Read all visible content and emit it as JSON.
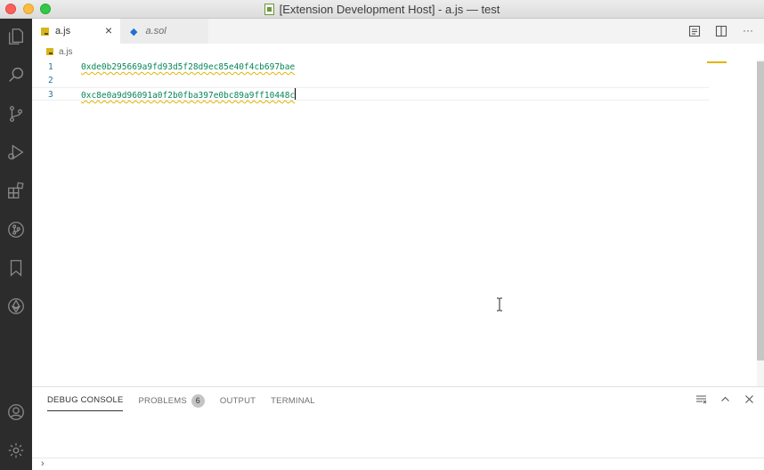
{
  "window": {
    "title": "[Extension Development Host] - a.js — test"
  },
  "activity_bar": {
    "items": [
      "explorer-icon",
      "search-icon",
      "source-control-icon",
      "run-debug-icon",
      "extensions-icon",
      "git-graph-icon",
      "bookmarks-icon",
      "ethereum-icon"
    ],
    "bottom_items": [
      "account-icon",
      "settings-gear-icon"
    ]
  },
  "tabs": [
    {
      "label": "a.js",
      "active": true,
      "icon": "js-file-icon"
    },
    {
      "label": "a.sol",
      "active": false,
      "icon": "ethereum-file-icon"
    }
  ],
  "tab_close": "×",
  "editor_actions": [
    "open-preview-icon",
    "split-editor-icon",
    "more-actions-icon"
  ],
  "editor_actions_more": "···",
  "breadcrumb": {
    "file": "a.js"
  },
  "editor": {
    "lines": [
      {
        "number": "1",
        "text": "0xde0b295669a9fd93d5f28d9ec85e40f4cb697bae"
      },
      {
        "number": "2",
        "text": ""
      },
      {
        "number": "3",
        "text": "0xc8e0a9d96091a0f2b0fba397e0bc89a9ff10448c"
      }
    ],
    "colors": {
      "code": "#098658",
      "line_number": "#237893",
      "warning_squiggle": "#e0b400"
    }
  },
  "panel": {
    "tabs": [
      {
        "label": "DEBUG CONSOLE",
        "active": true
      },
      {
        "label": "PROBLEMS",
        "badge": "6"
      },
      {
        "label": "OUTPUT"
      },
      {
        "label": "TERMINAL"
      }
    ],
    "actions": [
      "clear-console-icon",
      "maximize-panel-icon",
      "close-panel-icon"
    ],
    "prompt": "›"
  }
}
